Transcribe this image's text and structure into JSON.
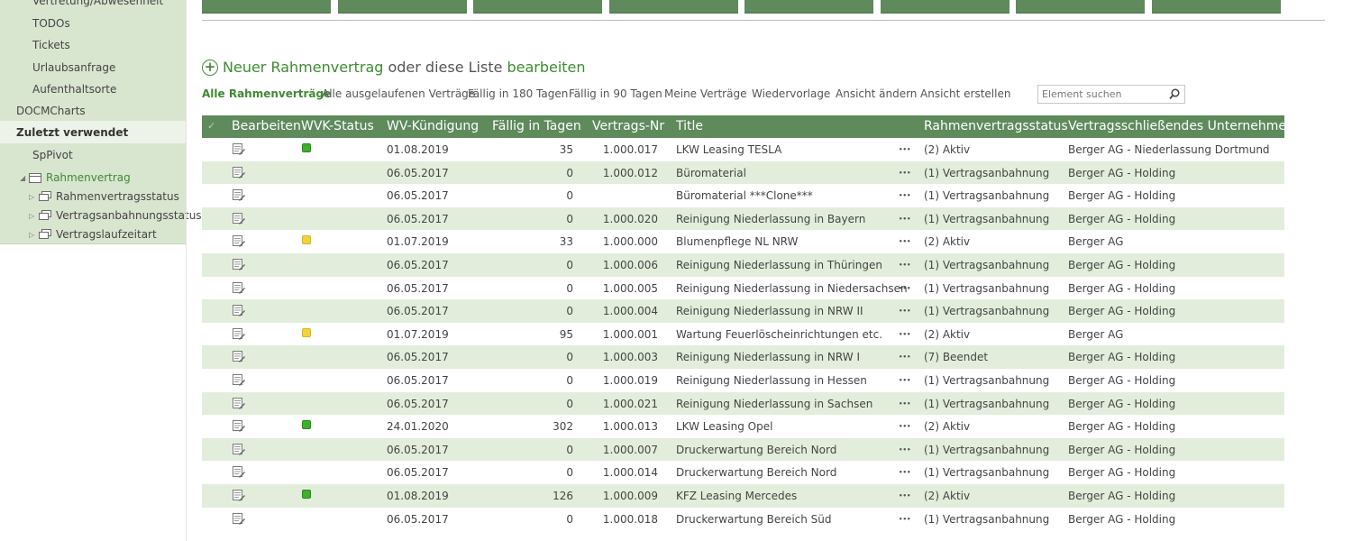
{
  "sidebar": {
    "items": [
      {
        "label": "Vertretung/Abwesenheit"
      },
      {
        "label": "TODOs"
      },
      {
        "label": "Tickets"
      },
      {
        "label": "Urlaubsanfrage"
      },
      {
        "label": "Aufenthaltsorte"
      },
      {
        "label": "DOCMCharts"
      },
      {
        "label": "Zuletzt verwendet"
      },
      {
        "label": "SpPivot"
      },
      {
        "label": "Rahmenvertrag"
      },
      {
        "label": "Rahmenvertragsstatus"
      },
      {
        "label": "Vertragsanbahnungsstatus"
      },
      {
        "label": "Vertragslaufzeitart"
      }
    ]
  },
  "new_item": {
    "link1": "Neuer Rahmenvertrag",
    "middle": "oder diese Liste",
    "link2": "bearbeiten"
  },
  "views": [
    {
      "label": "Alle Rahmenverträge"
    },
    {
      "label": "Alle ausgelaufenen Verträge"
    },
    {
      "label": "Fällig in 180 Tagen"
    },
    {
      "label": "Fällig in 90 Tagen"
    },
    {
      "label": "Meine Verträge"
    },
    {
      "label": "Wiedervorlage"
    },
    {
      "label": "Ansicht ändern"
    },
    {
      "label": "Ansicht erstellen"
    }
  ],
  "search": {
    "placeholder": "Element suchen"
  },
  "table": {
    "headers": {
      "edit": "Bearbeiten",
      "wvk": "WVK-Status",
      "wv": "WV-Kündigung",
      "due": "Fällig in Tagen",
      "nr": "Vertrags-Nr",
      "title": "Title",
      "status": "Rahmenvertragsstatus",
      "company": "Vertragsschließendes Unternehmen"
    },
    "status_colors": {
      "green": "#3cb02a",
      "yellow": "#f2d23a"
    },
    "rows": [
      {
        "wvk": "green",
        "wv": "01.08.2019",
        "due": "35",
        "nr": "1.000.017",
        "title": "LKW Leasing TESLA",
        "status": "(2) Aktiv",
        "company": "Berger AG - Niederlassung Dortmund"
      },
      {
        "wvk": "",
        "wv": "06.05.2017",
        "due": "0",
        "nr": "1.000.012",
        "title": "Büromaterial",
        "status": "(1) Vertragsanbahnung",
        "company": "Berger AG - Holding"
      },
      {
        "wvk": "",
        "wv": "06.05.2017",
        "due": "0",
        "nr": "",
        "title": "Büromaterial ***Clone***",
        "status": "(1) Vertragsanbahnung",
        "company": "Berger AG - Holding"
      },
      {
        "wvk": "",
        "wv": "06.05.2017",
        "due": "0",
        "nr": "1.000.020",
        "title": "Reinigung Niederlassung in Bayern",
        "status": "(1) Vertragsanbahnung",
        "company": "Berger AG - Holding"
      },
      {
        "wvk": "yellow",
        "wv": "01.07.2019",
        "due": "33",
        "nr": "1.000.000",
        "title": "Blumenpflege NL NRW",
        "status": "(2) Aktiv",
        "company": "Berger AG"
      },
      {
        "wvk": "",
        "wv": "06.05.2017",
        "due": "0",
        "nr": "1.000.006",
        "title": "Reinigung Niederlassung in Thüringen",
        "status": "(1) Vertragsanbahnung",
        "company": "Berger AG - Holding"
      },
      {
        "wvk": "",
        "wv": "06.05.2017",
        "due": "0",
        "nr": "1.000.005",
        "title": "Reinigung Niederlassung in Niedersachsen",
        "status": "(1) Vertragsanbahnung",
        "company": "Berger AG - Holding"
      },
      {
        "wvk": "",
        "wv": "06.05.2017",
        "due": "0",
        "nr": "1.000.004",
        "title": "Reinigung Niederlassung in NRW II",
        "status": "(1) Vertragsanbahnung",
        "company": "Berger AG - Holding"
      },
      {
        "wvk": "yellow",
        "wv": "01.07.2019",
        "due": "95",
        "nr": "1.000.001",
        "title": "Wartung Feuerlöscheinrichtungen etc.",
        "status": "(2) Aktiv",
        "company": "Berger AG"
      },
      {
        "wvk": "",
        "wv": "06.05.2017",
        "due": "0",
        "nr": "1.000.003",
        "title": "Reinigung Niederlassung in NRW I",
        "status": "(7) Beendet",
        "company": "Berger AG - Holding"
      },
      {
        "wvk": "",
        "wv": "06.05.2017",
        "due": "0",
        "nr": "1.000.019",
        "title": "Reinigung Niederlassung in Hessen",
        "status": "(1) Vertragsanbahnung",
        "company": "Berger AG - Holding"
      },
      {
        "wvk": "",
        "wv": "06.05.2017",
        "due": "0",
        "nr": "1.000.021",
        "title": "Reinigung Niederlassung in Sachsen",
        "status": "(1) Vertragsanbahnung",
        "company": "Berger AG - Holding"
      },
      {
        "wvk": "green",
        "wv": "24.01.2020",
        "due": "302",
        "nr": "1.000.013",
        "title": "LKW Leasing Opel",
        "status": "(2) Aktiv",
        "company": "Berger AG - Holding"
      },
      {
        "wvk": "",
        "wv": "06.05.2017",
        "due": "0",
        "nr": "1.000.007",
        "title": "Druckerwartung Bereich Nord",
        "status": "(1) Vertragsanbahnung",
        "company": "Berger AG - Holding"
      },
      {
        "wvk": "",
        "wv": "06.05.2017",
        "due": "0",
        "nr": "1.000.014",
        "title": "Druckerwartung Bereich Nord",
        "status": "(1) Vertragsanbahnung",
        "company": "Berger AG - Holding"
      },
      {
        "wvk": "green",
        "wv": "01.08.2019",
        "due": "126",
        "nr": "1.000.009",
        "title": "KFZ Leasing Mercedes",
        "status": "(2) Aktiv",
        "company": "Berger AG - Holding"
      },
      {
        "wvk": "",
        "wv": "06.05.2017",
        "due": "0",
        "nr": "1.000.018",
        "title": "Druckerwartung Bereich Süd",
        "status": "(1) Vertragsanbahnung",
        "company": "Berger AG - Holding"
      }
    ]
  }
}
